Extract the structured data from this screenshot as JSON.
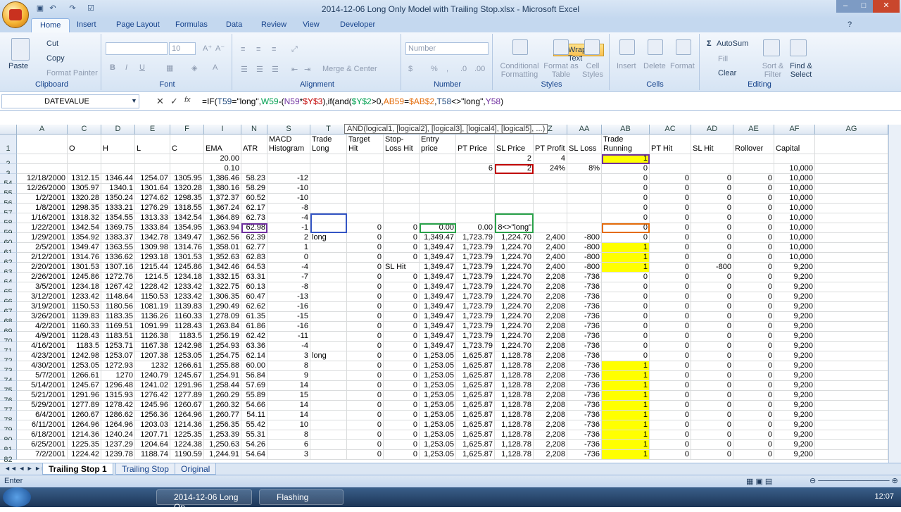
{
  "window": {
    "title": "2014-12-06 Long Only Model with Trailing Stop.xlsx - Microsoft Excel"
  },
  "tabs": [
    "Home",
    "Insert",
    "Page Layout",
    "Formulas",
    "Data",
    "Review",
    "View",
    "Developer"
  ],
  "ribbon": {
    "clipboard": {
      "label": "Clipboard",
      "paste": "Paste",
      "cut": "Cut",
      "copy": "Copy",
      "format_painter": "Format Painter"
    },
    "font": {
      "label": "Font",
      "size": "10"
    },
    "alignment": {
      "label": "Alignment",
      "wrap_text": "Wrap Text",
      "merge": "Merge & Center"
    },
    "number": {
      "label": "Number",
      "format": "Number"
    },
    "styles": {
      "label": "Styles",
      "conditional": "Conditional Formatting",
      "format_table": "Format as Table",
      "cell_styles": "Cell Styles"
    },
    "cells": {
      "label": "Cells",
      "insert": "Insert",
      "delete": "Delete",
      "format": "Format"
    },
    "editing": {
      "label": "Editing",
      "autosum": "AutoSum",
      "fill": "Fill",
      "clear": "Clear",
      "sort": "Sort & Filter",
      "find": "Find & Select"
    }
  },
  "formula_bar": {
    "name_box": "DATEVALUE",
    "fx": "fx",
    "formula_parts": [
      "=IF(",
      "T59",
      "=\"long\",",
      "W59",
      "-(",
      "N59",
      "*",
      "$Y$3",
      "),if(and(",
      "$Y$2",
      ">0,",
      "AB59",
      "=",
      "$AB$2",
      ",",
      "T58",
      "<>\"long\",",
      "Y58",
      ")"
    ]
  },
  "tooltip": "AND(logical1, [logical2], [logical3], [logical4], [logical5], ...)",
  "columns": [
    "A",
    "C",
    "D",
    "E",
    "F",
    "I",
    "N",
    "S",
    "T",
    "U",
    "V",
    "W",
    "X",
    "Y",
    "Z",
    "AA",
    "AB",
    "AC",
    "AD",
    "AE",
    "AF",
    "AG"
  ],
  "header_row": [
    "",
    "O",
    "H",
    "L",
    "C",
    "EMA",
    "ATR",
    "MACD Histogram",
    "Trade Long",
    "Profit Target Hit",
    "Stop-Loss Hit",
    "Entry price",
    "PT Price",
    "SL Price",
    "PT Profit",
    "SL Loss",
    "Trade Running",
    "PT Hit",
    "SL Hit",
    "Rollover",
    "Capital",
    ""
  ],
  "row2": {
    "I": "20.00",
    "Y": "2",
    "Z": "4",
    "AB": "1"
  },
  "row3": {
    "I": "0.10",
    "X": "6",
    "Y": "2",
    "Z": "24%",
    "AA": "8%",
    "AB": "0",
    "AF": "10,000"
  },
  "rows": [
    [
      "54",
      "12/18/2000",
      "1312.15",
      "1346.44",
      "1254.07",
      "1305.95",
      "1,386.46",
      "58.23",
      "-12",
      "",
      "",
      "",
      "",
      "",
      "",
      "",
      "",
      "0",
      "0",
      "0",
      "0",
      "10,000"
    ],
    [
      "55",
      "12/26/2000",
      "1305.97",
      "1340.1",
      "1301.64",
      "1320.28",
      "1,380.16",
      "58.29",
      "-10",
      "",
      "",
      "",
      "",
      "",
      "",
      "",
      "",
      "0",
      "0",
      "0",
      "0",
      "10,000"
    ],
    [
      "56",
      "1/2/2001",
      "1320.28",
      "1350.24",
      "1274.62",
      "1298.35",
      "1,372.37",
      "60.52",
      "-10",
      "",
      "",
      "",
      "",
      "",
      "",
      "",
      "",
      "0",
      "0",
      "0",
      "0",
      "10,000"
    ],
    [
      "57",
      "1/8/2001",
      "1298.35",
      "1333.21",
      "1276.29",
      "1318.55",
      "1,367.24",
      "62.17",
      "-8",
      "",
      "",
      "",
      "",
      "",
      "",
      "",
      "",
      "0",
      "0",
      "0",
      "0",
      "10,000"
    ],
    [
      "58",
      "1/16/2001",
      "1318.32",
      "1354.55",
      "1313.33",
      "1342.54",
      "1,364.89",
      "62.73",
      "-4",
      "",
      "",
      "",
      "",
      "",
      "",
      "",
      "",
      "0",
      "0",
      "0",
      "0",
      "10,000"
    ],
    [
      "59",
      "1/22/2001",
      "1342.54",
      "1369.75",
      "1333.84",
      "1354.95",
      "1,363.94",
      "62.98",
      "-1",
      "",
      "0",
      "0",
      "0.00",
      "0.00",
      "8<>\"long\"",
      "",
      "",
      "0",
      "0",
      "0",
      "0",
      "10,000"
    ],
    [
      "60",
      "1/29/2001",
      "1354.92",
      "1383.37",
      "1342.78",
      "1349.47",
      "1,362.56",
      "62.39",
      "2",
      "long",
      "0",
      "0",
      "1,349.47",
      "1,723.79",
      "1,224.70",
      "2,400",
      "-800",
      "0",
      "0",
      "0",
      "0",
      "10,000"
    ],
    [
      "61",
      "2/5/2001",
      "1349.47",
      "1363.55",
      "1309.98",
      "1314.76",
      "1,358.01",
      "62.77",
      "1",
      "",
      "0",
      "0",
      "1,349.47",
      "1,723.79",
      "1,224.70",
      "2,400",
      "-800",
      "1",
      "0",
      "0",
      "0",
      "10,000"
    ],
    [
      "62",
      "2/12/2001",
      "1314.76",
      "1336.62",
      "1293.18",
      "1301.53",
      "1,352.63",
      "62.83",
      "0",
      "",
      "0",
      "0",
      "1,349.47",
      "1,723.79",
      "1,224.70",
      "2,400",
      "-800",
      "1",
      "0",
      "0",
      "0",
      "10,000"
    ],
    [
      "63",
      "2/20/2001",
      "1301.53",
      "1307.16",
      "1215.44",
      "1245.86",
      "1,342.46",
      "64.53",
      "-4",
      "",
      "0",
      "SL Hit",
      "1,349.47",
      "1,723.79",
      "1,224.70",
      "2,400",
      "-800",
      "1",
      "0",
      "-800",
      "0",
      "9,200"
    ],
    [
      "64",
      "2/26/2001",
      "1245.86",
      "1272.76",
      "1214.5",
      "1234.18",
      "1,332.15",
      "63.31",
      "-7",
      "",
      "0",
      "0",
      "1,349.47",
      "1,723.79",
      "1,224.70",
      "2,208",
      "-736",
      "0",
      "0",
      "0",
      "0",
      "9,200"
    ],
    [
      "65",
      "3/5/2001",
      "1234.18",
      "1267.42",
      "1228.42",
      "1233.42",
      "1,322.75",
      "60.13",
      "-8",
      "",
      "0",
      "0",
      "1,349.47",
      "1,723.79",
      "1,224.70",
      "2,208",
      "-736",
      "0",
      "0",
      "0",
      "0",
      "9,200"
    ],
    [
      "66",
      "3/12/2001",
      "1233.42",
      "1148.64",
      "1150.53",
      "1233.42",
      "1,306.35",
      "60.47",
      "-13",
      "",
      "0",
      "0",
      "1,349.47",
      "1,723.79",
      "1,224.70",
      "2,208",
      "-736",
      "0",
      "0",
      "0",
      "0",
      "9,200"
    ],
    [
      "67",
      "3/19/2001",
      "1150.53",
      "1180.56",
      "1081.19",
      "1139.83",
      "1,290.49",
      "62.62",
      "-16",
      "",
      "0",
      "0",
      "1,349.47",
      "1,723.79",
      "1,224.70",
      "2,208",
      "-736",
      "0",
      "0",
      "0",
      "0",
      "9,200"
    ],
    [
      "68",
      "3/26/2001",
      "1139.83",
      "1183.35",
      "1136.26",
      "1160.33",
      "1,278.09",
      "61.35",
      "-15",
      "",
      "0",
      "0",
      "1,349.47",
      "1,723.79",
      "1,224.70",
      "2,208",
      "-736",
      "0",
      "0",
      "0",
      "0",
      "9,200"
    ],
    [
      "69",
      "4/2/2001",
      "1160.33",
      "1169.51",
      "1091.99",
      "1128.43",
      "1,263.84",
      "61.86",
      "-16",
      "",
      "0",
      "0",
      "1,349.47",
      "1,723.79",
      "1,224.70",
      "2,208",
      "-736",
      "0",
      "0",
      "0",
      "0",
      "9,200"
    ],
    [
      "70",
      "4/9/2001",
      "1128.43",
      "1183.51",
      "1126.38",
      "1183.5",
      "1,256.19",
      "62.42",
      "-11",
      "",
      "0",
      "0",
      "1,349.47",
      "1,723.79",
      "1,224.70",
      "2,208",
      "-736",
      "0",
      "0",
      "0",
      "0",
      "9,200"
    ],
    [
      "71",
      "4/16/2001",
      "1183.5",
      "1253.71",
      "1167.38",
      "1242.98",
      "1,254.93",
      "63.36",
      "-4",
      "",
      "0",
      "0",
      "1,349.47",
      "1,723.79",
      "1,224.70",
      "2,208",
      "-736",
      "0",
      "0",
      "0",
      "0",
      "9,200"
    ],
    [
      "72",
      "4/23/2001",
      "1242.98",
      "1253.07",
      "1207.38",
      "1253.05",
      "1,254.75",
      "62.14",
      "3",
      "long",
      "0",
      "0",
      "1,253.05",
      "1,625.87",
      "1,128.78",
      "2,208",
      "-736",
      "0",
      "0",
      "0",
      "0",
      "9,200"
    ],
    [
      "73",
      "4/30/2001",
      "1253.05",
      "1272.93",
      "1232",
      "1266.61",
      "1,255.88",
      "60.00",
      "8",
      "",
      "0",
      "0",
      "1,253.05",
      "1,625.87",
      "1,128.78",
      "2,208",
      "-736",
      "1",
      "0",
      "0",
      "0",
      "9,200"
    ],
    [
      "74",
      "5/7/2001",
      "1266.61",
      "1270",
      "1240.79",
      "1245.67",
      "1,254.91",
      "56.84",
      "9",
      "",
      "0",
      "0",
      "1,253.05",
      "1,625.87",
      "1,128.78",
      "2,208",
      "-736",
      "1",
      "0",
      "0",
      "0",
      "9,200"
    ],
    [
      "75",
      "5/14/2001",
      "1245.67",
      "1296.48",
      "1241.02",
      "1291.96",
      "1,258.44",
      "57.69",
      "14",
      "",
      "0",
      "0",
      "1,253.05",
      "1,625.87",
      "1,128.78",
      "2,208",
      "-736",
      "1",
      "0",
      "0",
      "0",
      "9,200"
    ],
    [
      "76",
      "5/21/2001",
      "1291.96",
      "1315.93",
      "1276.42",
      "1277.89",
      "1,260.29",
      "55.89",
      "15",
      "",
      "0",
      "0",
      "1,253.05",
      "1,625.87",
      "1,128.78",
      "2,208",
      "-736",
      "1",
      "0",
      "0",
      "0",
      "9,200"
    ],
    [
      "77",
      "5/29/2001",
      "1277.89",
      "1278.42",
      "1245.96",
      "1260.67",
      "1,260.32",
      "54.66",
      "14",
      "",
      "0",
      "0",
      "1,253.05",
      "1,625.87",
      "1,128.78",
      "2,208",
      "-736",
      "1",
      "0",
      "0",
      "0",
      "9,200"
    ],
    [
      "78",
      "6/4/2001",
      "1260.67",
      "1286.62",
      "1256.36",
      "1264.96",
      "1,260.77",
      "54.11",
      "14",
      "",
      "0",
      "0",
      "1,253.05",
      "1,625.87",
      "1,128.78",
      "2,208",
      "-736",
      "1",
      "0",
      "0",
      "0",
      "9,200"
    ],
    [
      "79",
      "6/11/2001",
      "1264.96",
      "1264.96",
      "1203.03",
      "1214.36",
      "1,256.35",
      "55.42",
      "10",
      "",
      "0",
      "0",
      "1,253.05",
      "1,625.87",
      "1,128.78",
      "2,208",
      "-736",
      "1",
      "0",
      "0",
      "0",
      "9,200"
    ],
    [
      "80",
      "6/18/2001",
      "1214.36",
      "1240.24",
      "1207.71",
      "1225.35",
      "1,253.39",
      "55.31",
      "8",
      "",
      "0",
      "0",
      "1,253.05",
      "1,625.87",
      "1,128.78",
      "2,208",
      "-736",
      "1",
      "0",
      "0",
      "0",
      "9,200"
    ],
    [
      "81",
      "6/25/2001",
      "1225.35",
      "1237.29",
      "1204.64",
      "1224.38",
      "1,250.63",
      "54.26",
      "6",
      "",
      "0",
      "0",
      "1,253.05",
      "1,625.87",
      "1,128.78",
      "2,208",
      "-736",
      "1",
      "0",
      "0",
      "0",
      "9,200"
    ],
    [
      "82",
      "7/2/2001",
      "1224.42",
      "1239.78",
      "1188.74",
      "1190.59",
      "1,244.91",
      "54.64",
      "3",
      "",
      "0",
      "0",
      "1,253.05",
      "1,625.87",
      "1,128.78",
      "2,208",
      "-736",
      "1",
      "0",
      "0",
      "0",
      "9,200"
    ]
  ],
  "sheets": [
    "Trailing Stop 1",
    "Trailing Stop",
    "Original"
  ],
  "status": {
    "mode": "Enter"
  },
  "taskbar": {
    "items": [
      "2014-12-06 Long On...",
      "Flashing"
    ],
    "clock": "12:07"
  },
  "colors": {
    "accent": "#ffff00",
    "ribbon": "#d6e4f4"
  }
}
